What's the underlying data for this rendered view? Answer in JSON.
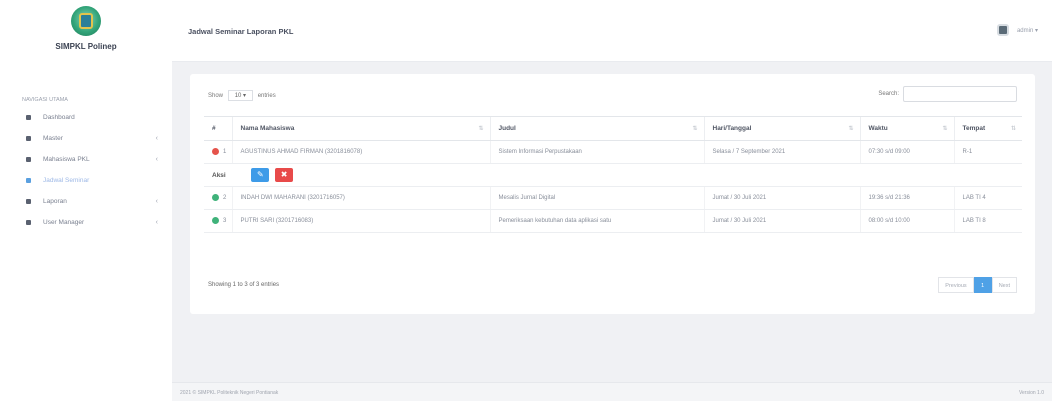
{
  "brand": {
    "name": "SIMPKL Polinep"
  },
  "sidebar": {
    "heading": "NAVIGASI UTAMA",
    "items": [
      {
        "label": "Dashboard",
        "chevron": "",
        "active": false
      },
      {
        "label": "Master",
        "chevron": "‹",
        "active": false
      },
      {
        "label": "Mahasiswa PKL",
        "chevron": "‹",
        "active": false
      },
      {
        "label": "Jadwal Seminar",
        "chevron": "",
        "active": true
      },
      {
        "label": "Laporan",
        "chevron": "‹",
        "active": false
      },
      {
        "label": "User Manager",
        "chevron": "‹",
        "active": false
      }
    ]
  },
  "header": {
    "title": "Jadwal Seminar Laporan PKL",
    "user": "admin ▾"
  },
  "table_controls": {
    "show_prefix": "Show",
    "show_value": "10 ▾",
    "show_suffix": "entries",
    "search_label": "Search:"
  },
  "table": {
    "headers": [
      "#",
      "Nama Mahasiswa",
      "Judul",
      "Hari/Tanggal",
      "Waktu",
      "Tempat"
    ],
    "rows": [
      {
        "no": "1",
        "nama": "AGUSTINUS AHMAD FIRMAN (3201816078)",
        "judul": "Sistem Informasi Perpustakaan",
        "tanggal": "Selasa / 7 September 2021",
        "waktu": "07:30 s/d 09:00",
        "tempat": "R-1",
        "status": "red"
      },
      {
        "no": "2",
        "nama": "INDAH DWI MAHARANI (3201716057)",
        "judul": "Mesalis Jurnal Digital",
        "tanggal": "Jumat / 30 Juli 2021",
        "waktu": "19:36 s/d 21:36",
        "tempat": "LAB TI 4",
        "status": "green"
      },
      {
        "no": "3",
        "nama": "PUTRI SARI (3201716083)",
        "judul": "Pemeriksaan kebutuhan data aplikasi satu",
        "tanggal": "Jumat / 30 Juli 2021",
        "waktu": "08:00 s/d 10:00",
        "tempat": "LAB TI 8",
        "status": "green"
      }
    ],
    "child_row": {
      "label": "Aksi",
      "edit_icon": "pencil-icon",
      "delete_icon": "x-icon"
    }
  },
  "footer_info": "Showing 1 to 3 of 3 entries",
  "pagination": {
    "prev": "Previous",
    "current": "1",
    "next": "Next"
  },
  "footer": {
    "copyright": "2021 © SIMPKL Politeknik Negeri Pontianak",
    "version": "Version 1.0"
  }
}
